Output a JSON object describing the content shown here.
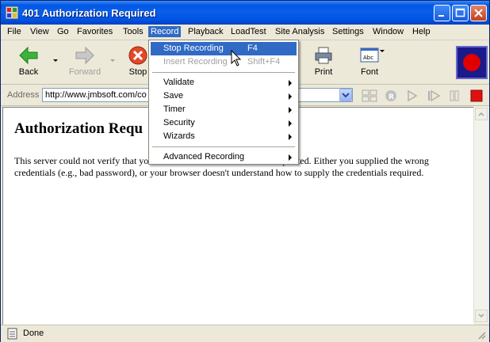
{
  "window": {
    "title": "401 Authorization Required"
  },
  "menubar": [
    "File",
    "View",
    "Go",
    "Favorites",
    "Tools",
    "Record",
    "Playback",
    "LoadTest",
    "Site Analysis",
    "Settings",
    "Window",
    "Help"
  ],
  "toolbar": {
    "back": "Back",
    "forward": "Forward",
    "stop": "Stop",
    "print": "Print",
    "font": "Font"
  },
  "address": {
    "label": "Address",
    "url": "http://www.jmbsoft.com/co"
  },
  "record_menu": {
    "stop_recording": "Stop Recording",
    "stop_key": "F4",
    "insert_recording": "Insert Recording",
    "insert_key": "Shift+F4",
    "validate": "Validate",
    "save": "Save",
    "timer": "Timer",
    "security": "Security",
    "wizards": "Wizards",
    "advanced_recording": "Advanced Recording"
  },
  "content": {
    "heading": "Authorization Requ",
    "para1": "This server could not verify that yo",
    "para2": "t requested. Either you supplied the wrong",
    "line2": "credentials (e.g., bad password), or your browser doesn't understand how to supply the credentials required."
  },
  "status": {
    "text": "Done"
  },
  "colors": {
    "titlebar": "#0054e3",
    "highlight": "#316ac5",
    "record": "#e00000"
  }
}
